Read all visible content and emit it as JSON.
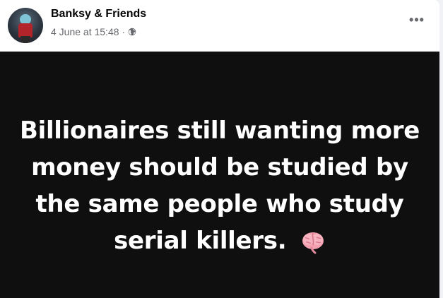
{
  "post": {
    "page_name": "Banksy & Friends",
    "date": "4 June at 15:48",
    "separator": "·",
    "privacy_icon": "globe-icon",
    "more_icon": "more-options-icon",
    "more_label": "•••",
    "image_text": "Billionaires still wanting more money should be studied by the same people who study serial killers.",
    "emoji_icon": "brain-icon"
  },
  "colors": {
    "image_background": "#0f0f0f",
    "image_text": "#ffffff",
    "name": "#050505",
    "meta": "#65676b",
    "brain_pink": "#f4a0b0"
  }
}
